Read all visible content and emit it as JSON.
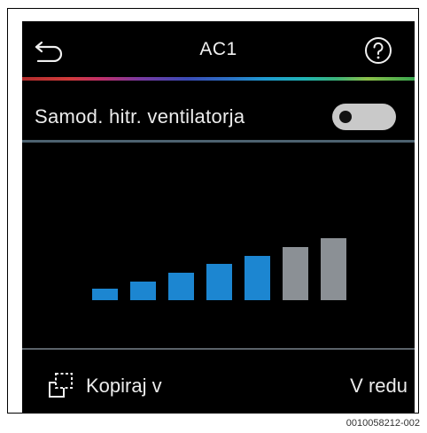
{
  "header": {
    "title": "AC1",
    "back_icon": "back-arrow-icon",
    "help_icon": "help-icon"
  },
  "toggle_row": {
    "label": "Samod. hitr. ventilatorja",
    "state": "off"
  },
  "fan_speed": {
    "total_levels": 7,
    "active_levels": 5,
    "bar_heights_relative": [
      0.19,
      0.3,
      0.44,
      0.58,
      0.71,
      0.85,
      1.0
    ],
    "colors": {
      "active": "#1c86d1",
      "inactive": "#8b9095"
    }
  },
  "footer": {
    "copy_label": "Kopiraj v",
    "ok_label": "V redu",
    "copy_icon": "copy-icon"
  },
  "caption": "0010058212-002"
}
